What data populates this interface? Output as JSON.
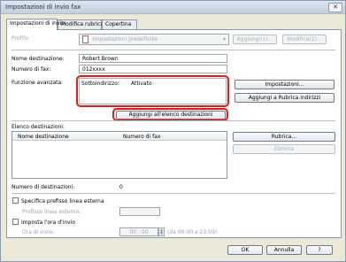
{
  "window": {
    "title": "Impostazioni di invio fax",
    "close_glyph": "✕"
  },
  "tabs": [
    {
      "label": "Impostazioni di invio"
    },
    {
      "label": "Modifica rubrica"
    },
    {
      "label": "Copertina"
    }
  ],
  "profile": {
    "label": "Profilo:",
    "value": "Impostazioni predefinite",
    "icon": "profile-document-icon",
    "add_label": "Aggiungi(1)...",
    "modify_label": "Modifica(2)..."
  },
  "recipient": {
    "name_label": "Nome destinazione:",
    "name_value": "Robert Brown",
    "fax_label": "Numero di fax:",
    "fax_value": "012xxxx"
  },
  "function": {
    "label": "Funzione avanzata:",
    "setting_label": "Sottoindirizzo:",
    "setting_value": "Attivato",
    "settings_button": "Impostazioni...",
    "add_to_book_button": "Aggiungi a Rubrica indirizzi"
  },
  "add_to_list_button": "Aggiungi all'elenco destinazioni",
  "destinations": {
    "label": "Elenco destinazioni:",
    "columns": [
      "Nome destinazione",
      "Numero di fax"
    ],
    "rows": [],
    "address_book_button": "Rubrica...",
    "delete_button": "Elimina",
    "count_label": "Numero di destinazioni:",
    "count_value": "0"
  },
  "outside_line": {
    "checkbox_label": "Specifica prefisso linea esterna",
    "prefix_label": "Prefisso linea esterna:",
    "prefix_value": ""
  },
  "schedule": {
    "checkbox_label": "Imposta l'ora d'invio",
    "time_label": "Ora di invio:",
    "time_value": "00 : 00",
    "range_hint": "(da 00:00 a 23:59)"
  },
  "footer": {
    "ok": "OK",
    "cancel": "Annulla",
    "help": "?"
  },
  "colors": {
    "highlight": "#e41b1b",
    "dialog_bg": "#ece9d8"
  }
}
